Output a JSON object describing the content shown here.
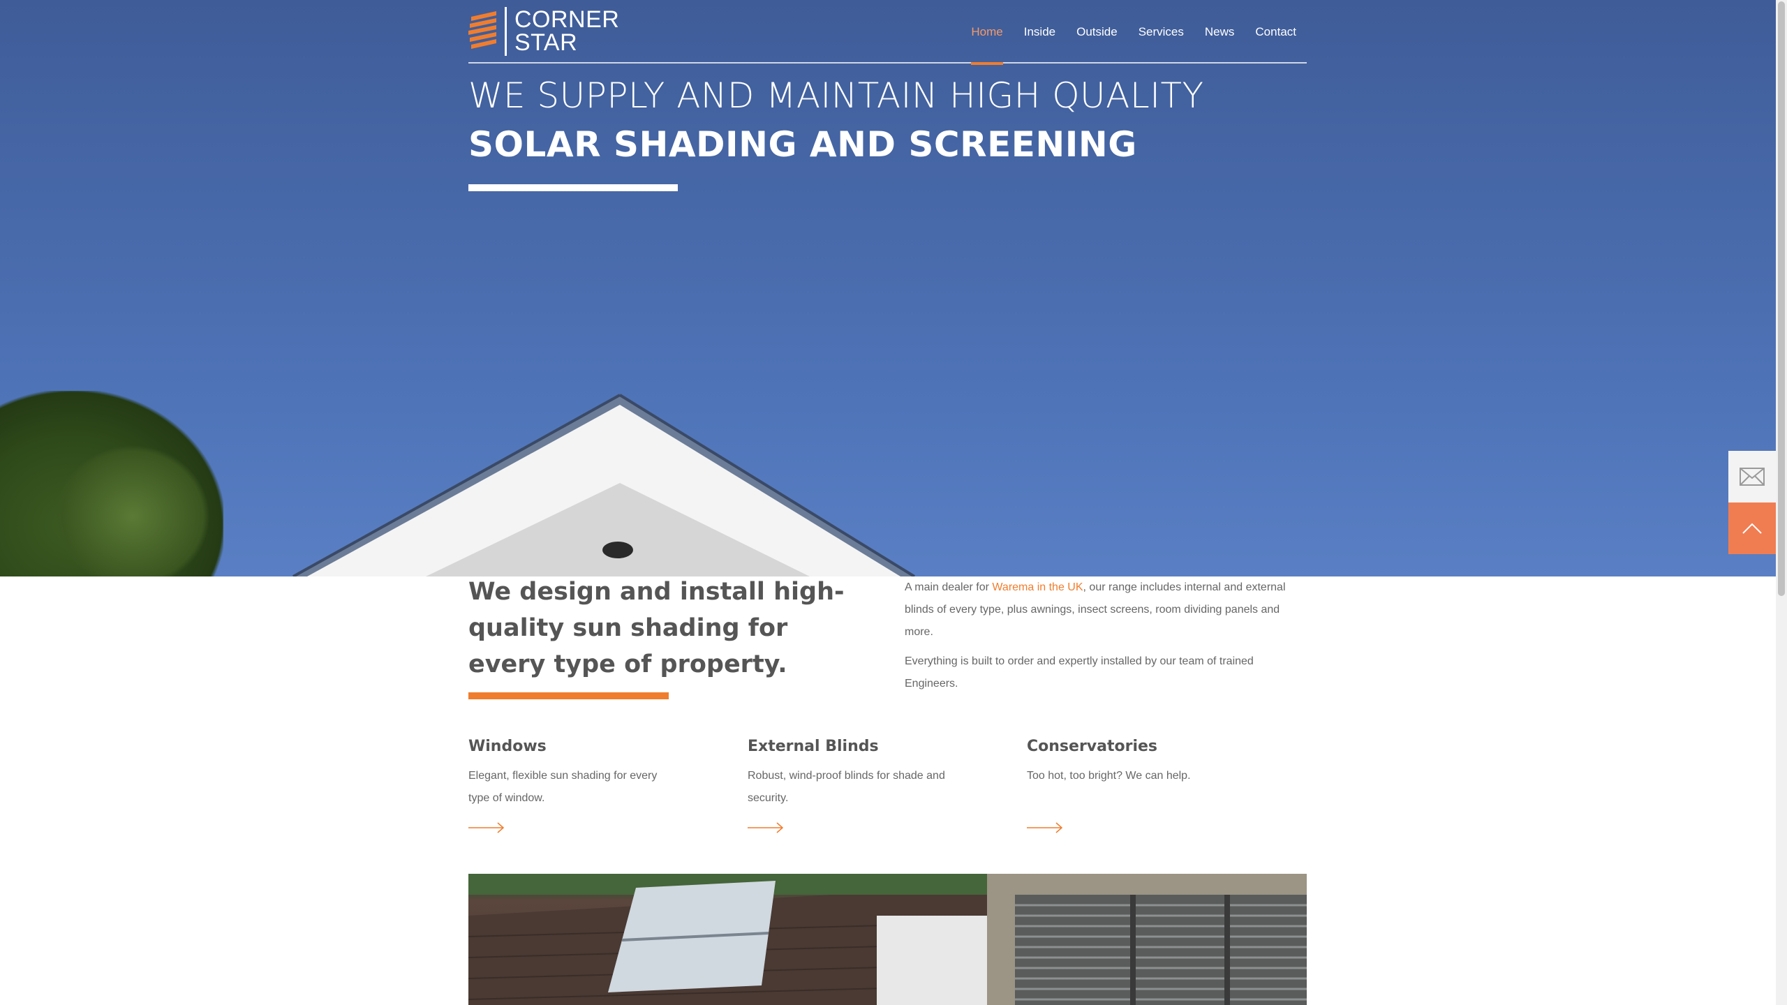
{
  "logo": {
    "line1": "CORNER",
    "line2": "STAR"
  },
  "nav": {
    "items": [
      {
        "label": "Home",
        "active": true
      },
      {
        "label": "Inside"
      },
      {
        "label": "Outside"
      },
      {
        "label": "Services"
      },
      {
        "label": "News"
      },
      {
        "label": "Contact"
      }
    ]
  },
  "hero": {
    "title_line1": "WE SUPPLY AND MAINTAIN HIGH QUALITY",
    "title_line2": "SOLAR SHADING AND SCREENING"
  },
  "intro": {
    "heading": "We design and install high-quality sun shading for every type of property.",
    "para1_before": "A main dealer for ",
    "para1_link": "Warema in the UK",
    "para1_after": ", our range includes internal and external blinds of every type, plus awnings, insect screens, room dividing panels and more.",
    "para2": "Everything is built to order and expertly installed by our team of trained Engineers."
  },
  "features": [
    {
      "title": "Windows",
      "text": "Elegant, flexible sun shading for every type of window."
    },
    {
      "title": "External Blinds",
      "text": "Robust, wind-proof blinds for shade and security."
    },
    {
      "title": "Conservatories",
      "text": "Too hot, too bright? We can help."
    }
  ],
  "colors": {
    "accent": "#f07d2e",
    "hero_sky": "#4a6aa8",
    "text_dark": "#555555",
    "text_body": "#666666"
  },
  "icons": {
    "mail": "mail-icon",
    "back_to_top": "chevron-up-icon",
    "feature_arrow": "arrow-right-icon"
  }
}
